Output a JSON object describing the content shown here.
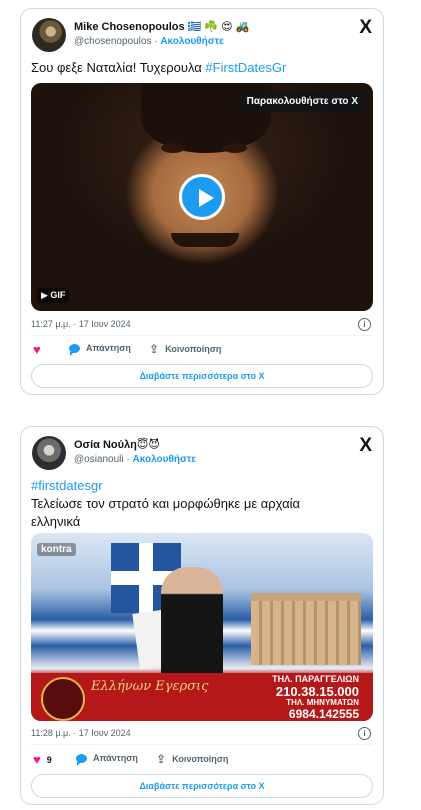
{
  "tweets": [
    {
      "author": "Mike Chosenopoulos 🇬🇷 ☘️ 😍 🚜",
      "handle": "@chosenopoulos",
      "follow_label": "Ακολουθήστε",
      "text_main": "Σου φεξε Ναταλία! Τυχερουλα ",
      "hashtag": "#FirstDatesGr",
      "watch_label": "Παρακολουθήστε στο Χ",
      "media_badge": "GIF",
      "date": "11:27 μ.μ. · 17 Ιουν 2024",
      "reply_label": "Απάντηση",
      "share_label": "Κοινοποίηση",
      "read_more": "Διαβάστε περισσότερα στο Χ"
    },
    {
      "author": "Οσία Νούλη😇😈",
      "handle": "@osianouli",
      "follow_label": "Ακολουθήστε",
      "hashtag": "#firstdatesgr",
      "text_line1": "Τελείωσε τον στρατό και μορφώθηκε με αρχαία",
      "text_line2": "ελληνικά",
      "media_channel": "kontra",
      "media_banner_script": "Ελλήνων Εγερσις",
      "media_tel_label": "ΤΗΛ. ΠΑΡΑΓΓΕΛΙΩΝ",
      "media_tel_number": "210.38.15.000",
      "media_sms_label": "ΤΗΛ. ΜΗΝΥΜΑΤΩΝ",
      "media_sms_number": "6984.142555",
      "date": "11:28 μ.μ. · 17 Ιουν 2024",
      "like_count": "9",
      "reply_label": "Απάντηση",
      "share_label": "Κοινοποίηση",
      "read_more": "Διαβάστε περισσότερα στο Χ"
    }
  ],
  "colors": {
    "accent": "#1d9bf0",
    "like": "#f91880",
    "muted": "#536471",
    "border": "#cfd9de"
  },
  "icons": {
    "x_logo": "X",
    "info": "i",
    "heart": "♥",
    "share": "⇪"
  }
}
